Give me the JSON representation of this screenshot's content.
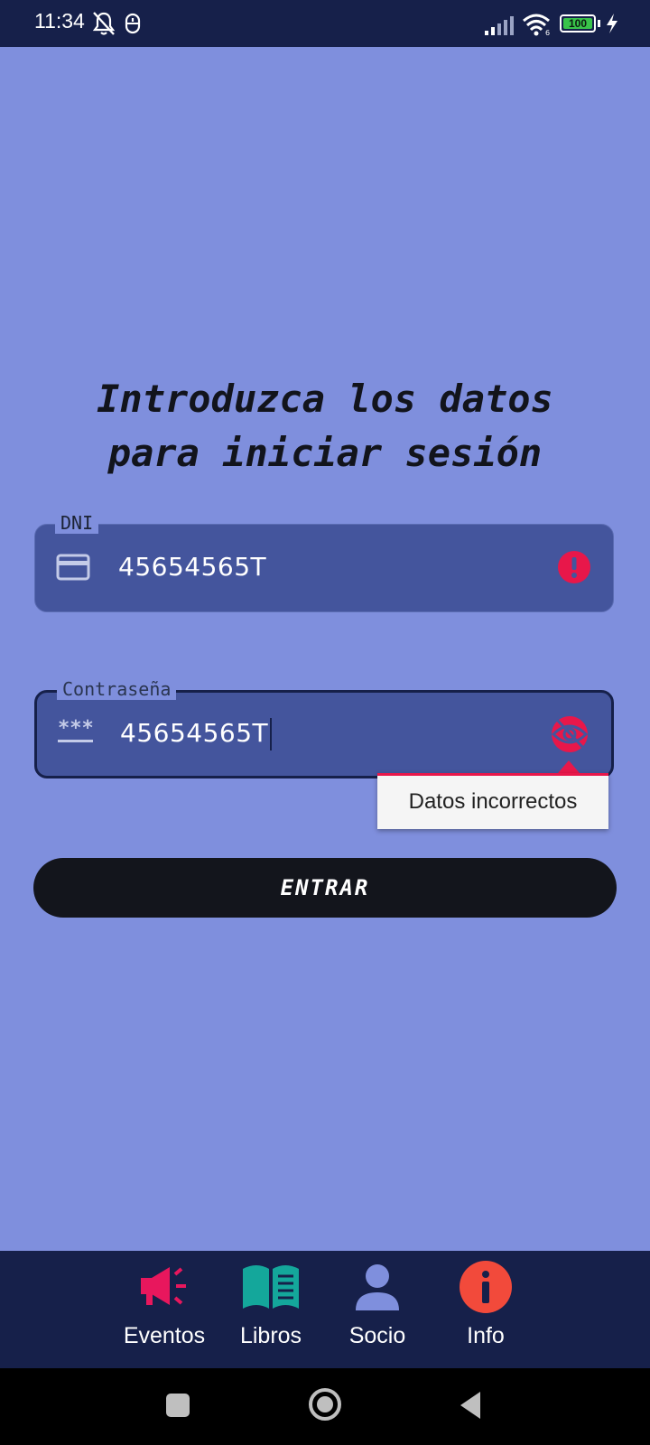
{
  "status_bar": {
    "time": "11:34",
    "battery": "100",
    "icons": [
      "bell-off-icon",
      "mouse-icon",
      "signal-icon",
      "wifi-icon",
      "battery-icon",
      "charging-icon"
    ]
  },
  "heading": {
    "line1": "Introduzca los datos",
    "line2": "para iniciar sesión"
  },
  "dni_field": {
    "label": "DNI",
    "value": "45654565T",
    "leading_icon": "card-icon",
    "trailing_icon": "error-icon"
  },
  "password_field": {
    "label": "Contraseña",
    "value": "45654565T",
    "leading_icon": "password-icon",
    "trailing_icon": "eye-off-icon"
  },
  "error_popup": {
    "text": "Datos incorrectos"
  },
  "enter_button": {
    "label": "ENTRAR"
  },
  "bottom_nav": {
    "items": [
      {
        "label": "Eventos",
        "icon": "megaphone-icon"
      },
      {
        "label": "Libros",
        "icon": "book-icon"
      },
      {
        "label": "Socio",
        "icon": "person-icon"
      },
      {
        "label": "Info",
        "icon": "info-icon"
      }
    ]
  },
  "colors": {
    "background": "#7f8fdd",
    "field": "#44559d",
    "nav": "#16204a",
    "error": "#e8174a",
    "button": "#13151c"
  }
}
